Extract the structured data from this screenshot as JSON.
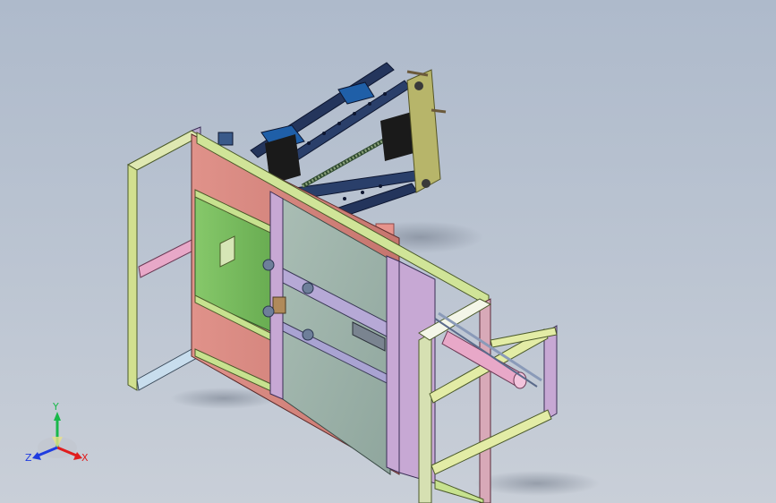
{
  "viewport": {
    "background_top": "#aebacb",
    "background_bottom": "#c9cfd8"
  },
  "model": {
    "name": "",
    "view": "isometric",
    "colors": {
      "frame_green": "#c9dc8a",
      "frame_violet": "#c7a8d4",
      "panel_green": "#7fbf62",
      "panel_red": "#d8857e",
      "panel_glass": "#9ab0a8",
      "steel_blue": "#2a3f6a",
      "plate_olive": "#b7b56a",
      "rod_pink": "#e8a8c8"
    }
  },
  "triad": {
    "x_label": "X",
    "y_label": "Y",
    "z_label": "Z",
    "x_color": "#e01d1d",
    "y_color": "#19b84a",
    "z_color": "#1f3ce0"
  }
}
